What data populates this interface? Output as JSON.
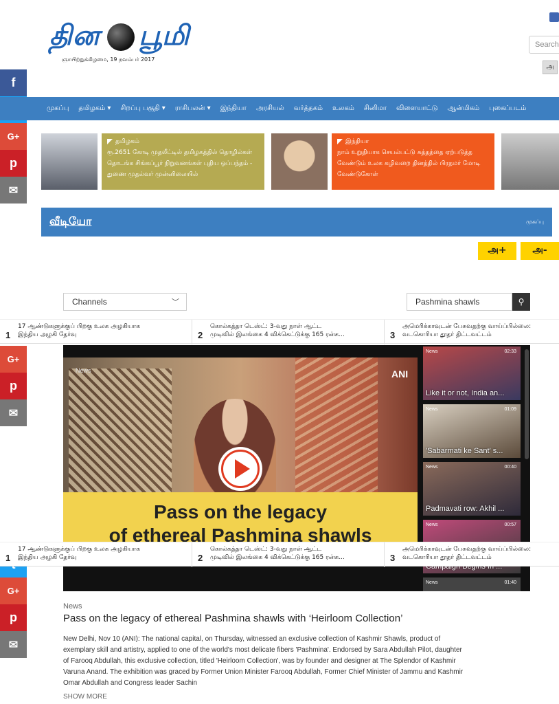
{
  "header": {
    "logo_left": "தின",
    "logo_right": "பூமி",
    "date": "ஞாயிற்றுக்கிழமை, 19 நவம்பர் 2017",
    "search_placeholder": "Search",
    "lang_button": "அ"
  },
  "social": {
    "facebook": "f",
    "twitter": "t",
    "googleplus": "G+",
    "pinterest": "p",
    "email": "✉"
  },
  "nav": [
    "முகப்பு",
    "தமிழகம் ▾",
    "சிறப்பு பகுதி ▾",
    "ராசிபலன் ▾",
    "இந்தியா",
    "அரசியல்",
    "வர்த்தகம்",
    "உலகம்",
    "சினிமா",
    "விளையாட்டு",
    "ஆன்மிகம்",
    "புகைப்படம்"
  ],
  "teasers": [
    {
      "category": "தமிழகம்",
      "text": "ரூ.2651 கோடி முதலீட்டில் தமிழகத்தில் தொழில்கள் தொடங்க சிங்கப்பூர் நிறுவனங்கள் புதிய ஒப்பந்தம் - துணை முதல்வர் முன்னிலையில்",
      "color": "#b5aa52"
    },
    {
      "category": "இந்தியா",
      "text": "நாம் உறுதியாக செயல்பட்டு சுத்தத்தை ஏற்படுத்த வேண்டும் உலக கழிவறை தினத்தில் பிரதமர் மோடி வேண்டுகோள்",
      "color": "#f05a1e"
    }
  ],
  "video_section": {
    "title": "வீடியோ",
    "breadcrumb": "முகப்பு",
    "font_increase": "அ+",
    "font_decrease": "அ-"
  },
  "filters": {
    "channels_label": "Channels",
    "search_value": "Pashmina shawls"
  },
  "trending": [
    {
      "num": "1",
      "line1": "17 ஆண்டுகளுக்குப் பிறகு உலக அழகியாக",
      "line2": "இந்திய அழகி தேர்வு"
    },
    {
      "num": "2",
      "line1": "கொல்கத்தா டெஸ்ட்: 3-வது நாள் ஆட்ட",
      "line2": "முடிவில் இலங்கை 4 விக்கெட்டுக்கு 165 ரன்க..."
    },
    {
      "num": "3",
      "line1": "அமெரிக்காவுடன் பேசுவதற்கு வாய்ப்பில்லை:",
      "line2": "வடகொரியா தூதர் திட்டவட்டம்"
    }
  ],
  "player": {
    "news_tag": "News",
    "brand": "ANI",
    "caption_line1": "Pass on the legacy",
    "caption_line2": "of ethereal Pashmina shawls"
  },
  "playlist": [
    {
      "tag": "News",
      "dur": "02:33",
      "cap": "Like it or not, India an..."
    },
    {
      "tag": "News",
      "dur": "01:09",
      "cap": "'Sabarmati ke Sant' s..."
    },
    {
      "tag": "News",
      "dur": "00:40",
      "cap": "Padmavati row: Akhil ..."
    },
    {
      "tag": "News",
      "dur": "00:57",
      "cap": "Campaign Begins In ..."
    },
    {
      "tag": "News",
      "dur": "01:40",
      "cap": ""
    }
  ],
  "article": {
    "category": "News",
    "title": "Pass on the legacy of ethereal Pashmina shawls with ‘Heirloom Collection’",
    "body": "New Delhi, Nov 10 (ANI): The national capital, on Thursday, witnessed an exclusive collection of Kashmir Shawls, product of exemplary skill and artistry, applied to one of the world's most delicate fibers 'Pashmina'. Endorsed by Sara Abdullah Pilot, daughter of Farooq Abdullah, this exclusive collection, titled 'Heirloom Collection', was by founder and designer at The Splendor of Kashmir Varuna Anand. The exhibition was graced by Former Union Minister Farooq Abdullah, Former Chief Minister of Jammu and Kashmir Omar Abdullah and Congress leader Sachin",
    "show_more": "SHOW MORE"
  }
}
